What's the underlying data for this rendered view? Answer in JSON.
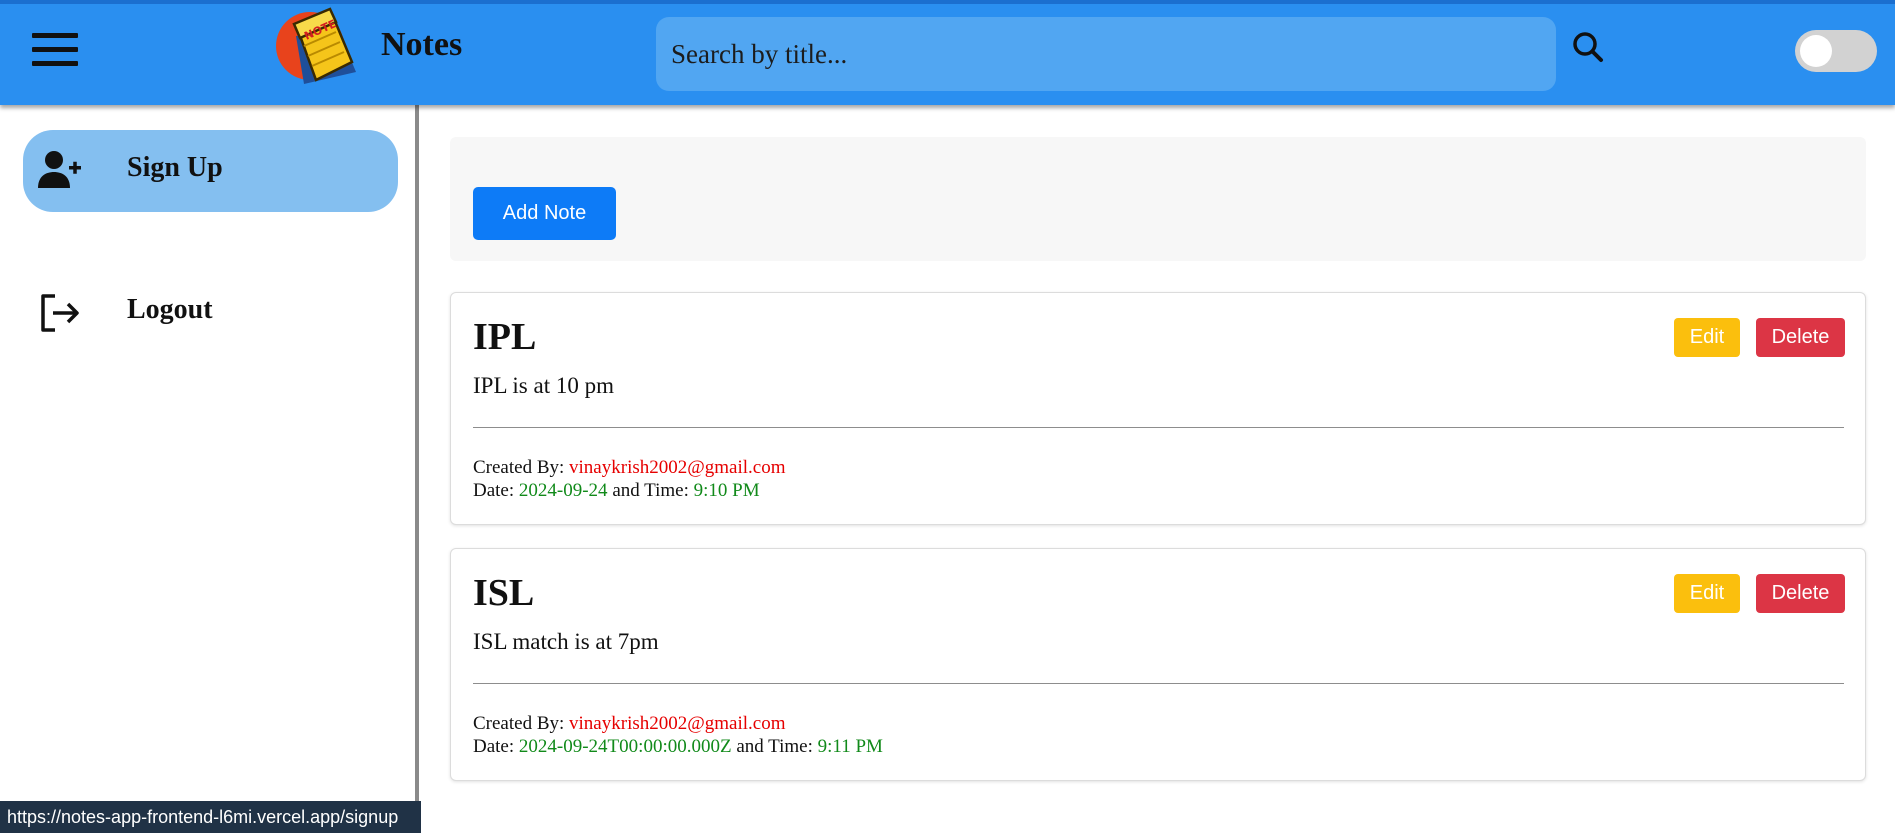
{
  "header": {
    "brand_title": "Notes",
    "logo_text": "NOTE",
    "search_placeholder": "Search by title...",
    "search_value": "",
    "theme_toggle_on": false
  },
  "sidebar": {
    "items": [
      {
        "label": "Sign Up",
        "icon": "user-plus-icon",
        "active": true
      },
      {
        "label": "Logout",
        "icon": "logout-icon",
        "active": false
      }
    ]
  },
  "main": {
    "add_note_label": "Add Note",
    "notes": [
      {
        "title": "IPL",
        "body": "IPL is at 10 pm",
        "created_by_label": "Created By:",
        "created_by": "vinaykrish2002@gmail.com",
        "date_label": "Date:",
        "date": "2024-09-24",
        "time_label": "and Time:",
        "time": "9:10 PM",
        "edit_label": "Edit",
        "delete_label": "Delete"
      },
      {
        "title": "ISL",
        "body": "ISL match is at 7pm",
        "created_by_label": "Created By:",
        "created_by": "vinaykrish2002@gmail.com",
        "date_label": "Date:",
        "date": "2024-09-24T00:00:00.000Z",
        "time_label": "and Time:",
        "time": "9:11 PM",
        "edit_label": "Edit",
        "delete_label": "Delete"
      }
    ]
  },
  "status_bar": {
    "url": "https://notes-app-frontend-l6mi.vercel.app/signup"
  },
  "colors": {
    "header_bg": "#2a8ff0",
    "active_nav_bg": "#84bff0",
    "primary_button": "#0d7bf7",
    "edit_button": "#fbbf0d",
    "delete_button": "#dc3545",
    "email_text": "#e60000",
    "datetime_text": "#118a1a"
  }
}
